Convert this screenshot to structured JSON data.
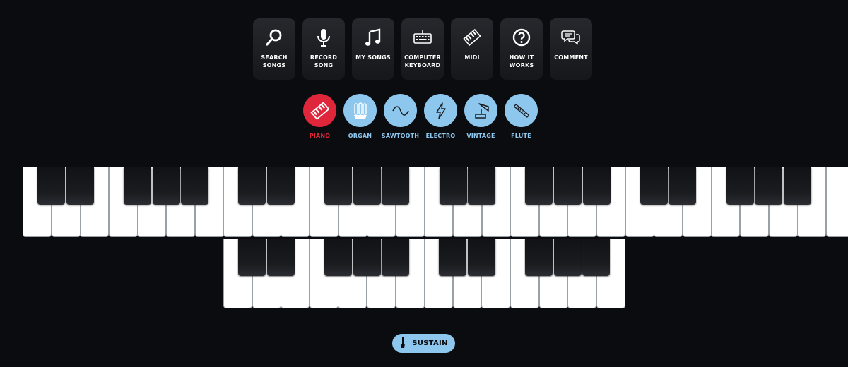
{
  "menu": [
    {
      "name": "search-songs-button",
      "icon": "search-icon",
      "label": "SEARCH\nSONGS"
    },
    {
      "name": "record-song-button",
      "icon": "microphone-icon",
      "label": "RECORD\nSONG"
    },
    {
      "name": "my-songs-button",
      "icon": "music-note-icon",
      "label": "MY SONGS"
    },
    {
      "name": "computer-keyboard-button",
      "icon": "keyboard-icon",
      "label": "COMPUTER\nKEYBOARD"
    },
    {
      "name": "midi-button",
      "icon": "midi-keyboard-icon",
      "label": "MIDI"
    },
    {
      "name": "how-it-works-button",
      "icon": "question-icon",
      "label": "HOW IT\nWORKS"
    },
    {
      "name": "comment-button",
      "icon": "comment-icon",
      "label": "COMMENT"
    }
  ],
  "instruments": [
    {
      "name": "instrument-piano",
      "icon": "piano-icon",
      "label": "PIANO",
      "active": true
    },
    {
      "name": "instrument-organ",
      "icon": "organ-icon",
      "label": "ORGAN",
      "active": false
    },
    {
      "name": "instrument-sawtooth",
      "icon": "wave-icon",
      "label": "SAWTOOTH",
      "active": false
    },
    {
      "name": "instrument-electro",
      "icon": "lightning-icon",
      "label": "ELECTRO",
      "active": false
    },
    {
      "name": "instrument-vintage",
      "icon": "gramophone-icon",
      "label": "VINTAGE",
      "active": false
    },
    {
      "name": "instrument-flute",
      "icon": "flute-icon",
      "label": "FLUTE",
      "active": false
    }
  ],
  "keyboard": {
    "top_row_octaves": 4,
    "extra_top_white_key": true,
    "bottom_row_octaves": 2,
    "white_key_color": "#ffffff",
    "black_key_color": "#16171b"
  },
  "sustain": {
    "icon": "pedal-icon",
    "label": "SUSTAIN"
  },
  "colors": {
    "background": "#0b0c10",
    "accent_blue": "#8ec7ee",
    "accent_red": "#e0263b",
    "menu_button": "#1f2125"
  }
}
